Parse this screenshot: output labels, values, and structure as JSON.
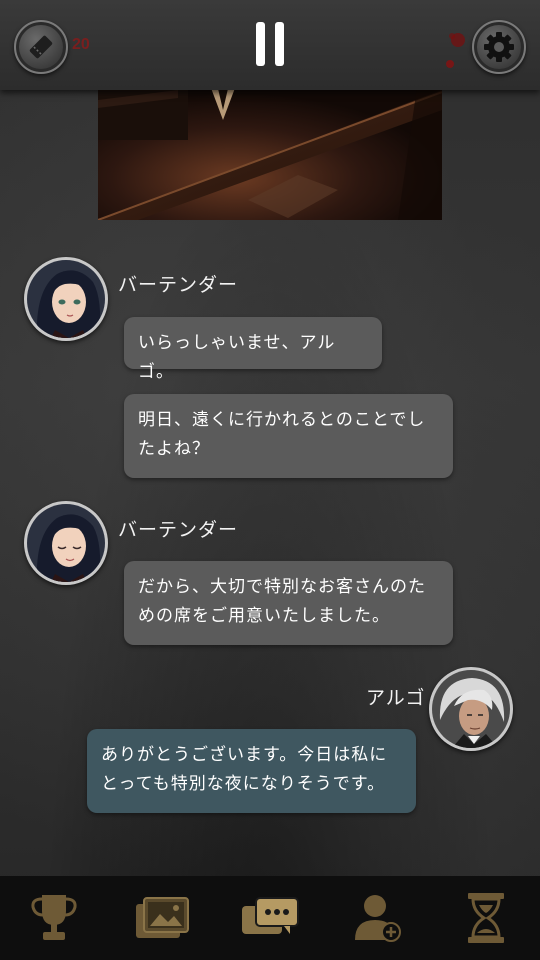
{
  "header": {
    "ticket_count": "20",
    "ticket_icon": "ticket-icon",
    "pause_icon": "pause-icon",
    "settings_icon": "gear-icon"
  },
  "scene": {
    "icon": "bar-scene-illustration"
  },
  "messages": [
    {
      "speaker": "バーテンダー",
      "avatar": "bartender-portrait-smiling",
      "lines": [
        "いらっしゃいませ、アルゴ。",
        "明日、遠くに行かれるとのことでし\nたよね？"
      ]
    },
    {
      "speaker": "バーテンダー",
      "avatar": "bartender-portrait-winking",
      "lines": [
        "だから、大切で特別なお客さんのた\nめの席をご用意いたしました。"
      ]
    },
    {
      "speaker": "アルゴ",
      "avatar": "argo-portrait",
      "lines": [
        "ありがとうございます。今日は私に\nとっても特別な夜になりそうです。"
      ]
    }
  ],
  "nav": {
    "items": [
      {
        "icon": "trophy-icon"
      },
      {
        "icon": "gallery-icon"
      },
      {
        "icon": "chat-icon"
      },
      {
        "icon": "add-character-icon"
      },
      {
        "icon": "hourglass-icon"
      }
    ]
  },
  "colors": {
    "npc_bubble": "#5b5b5b",
    "player_bubble": "#3f5760",
    "nav_icon": "#6e5a36",
    "nav_icon_active": "#b59a63",
    "ticket_count": "#7a1e1e"
  }
}
